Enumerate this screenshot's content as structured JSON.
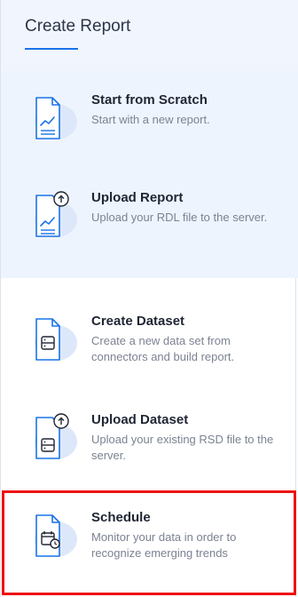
{
  "panel": {
    "title": "Create Report",
    "accent_color": "#1a73e8",
    "highlight_color": "#ee1111"
  },
  "items": [
    {
      "title": "Start from Scratch",
      "desc": "Start with a new report.",
      "icon": "new-report-icon"
    },
    {
      "title": "Upload Report",
      "desc": "Upload your RDL file to the server.",
      "icon": "upload-report-icon"
    },
    {
      "title": "Create Dataset",
      "desc": "Create a new data set from connectors and build report.",
      "icon": "dataset-icon"
    },
    {
      "title": "Upload Dataset",
      "desc": "Upload your existing RSD file to the server.",
      "icon": "upload-dataset-icon"
    },
    {
      "title": "Schedule",
      "desc": "Monitor your data in order to recognize emerging trends",
      "icon": "schedule-icon"
    }
  ]
}
